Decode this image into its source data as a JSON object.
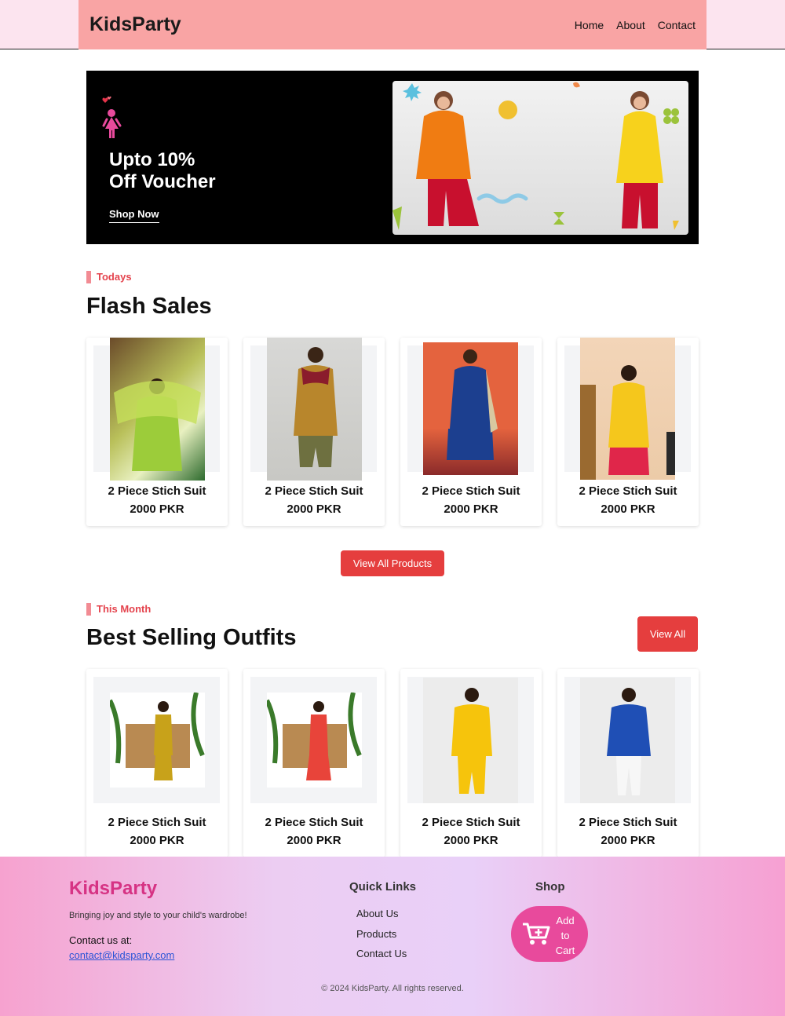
{
  "header": {
    "logo": "KidsParty",
    "nav": [
      "Home",
      "About",
      "Contact"
    ]
  },
  "hero": {
    "title": "Upto 10%\nOff Voucher",
    "cta": "Shop Now"
  },
  "flash": {
    "tag": "Todays",
    "title": "Flash Sales",
    "products": [
      {
        "name": "2 Piece Stich Suit",
        "price": "2000 PKR"
      },
      {
        "name": "2 Piece Stich Suit",
        "price": "2000 PKR"
      },
      {
        "name": "2 Piece Stich Suit",
        "price": "2000 PKR"
      },
      {
        "name": "2 Piece Stich Suit",
        "price": "2000 PKR"
      }
    ],
    "view_all": "View All Products"
  },
  "best": {
    "tag": "This Month",
    "title": "Best Selling Outfits",
    "view_all": "View All",
    "products": [
      {
        "name": "2 Piece Stich Suit",
        "price": "2000 PKR"
      },
      {
        "name": "2 Piece Stich Suit",
        "price": "2000 PKR"
      },
      {
        "name": "2 Piece Stich Suit",
        "price": "2000 PKR"
      },
      {
        "name": "2 Piece Stich Suit",
        "price": "2000 PKR"
      }
    ]
  },
  "footer": {
    "logo": "KidsParty",
    "tagline": "Bringing joy and style to your child's wardrobe!",
    "contact_label": "Contact us at:",
    "email": "contact@kidsparty.com",
    "quick_links_title": "Quick Links",
    "links": [
      "About Us",
      "Products",
      "Contact Us"
    ],
    "shop_title": "Shop",
    "cart_label": "Add to Cart",
    "cart_icon": "shopping-cart-icon",
    "copyright": "© 2024 KidsParty. All rights reserved."
  },
  "colors": {
    "accent": "#e53e3e",
    "header_bg": "#f9a4a4",
    "brand_pink": "#d63384"
  }
}
